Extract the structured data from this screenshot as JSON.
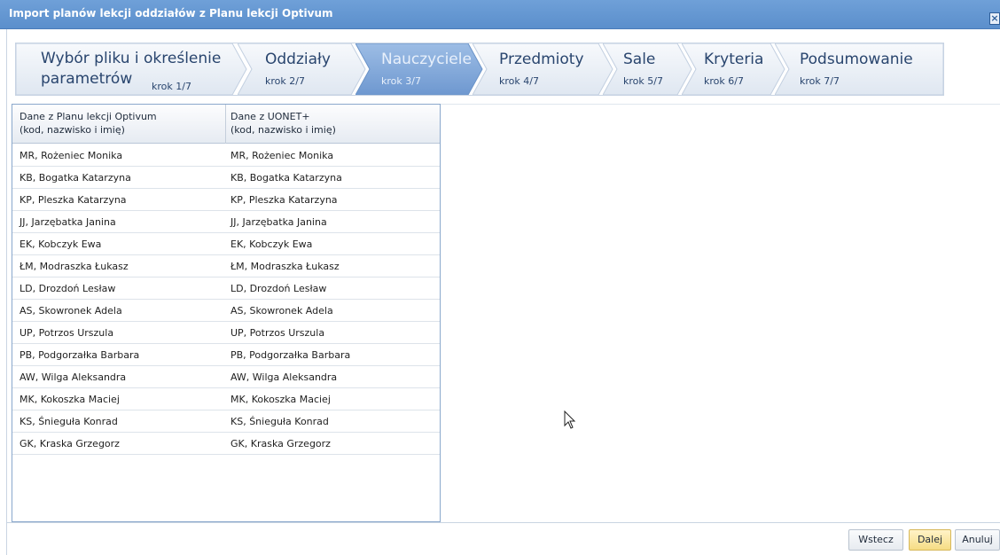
{
  "window": {
    "title": "Import planów lekcji oddziałów z Planu lekcji Optivum",
    "close_icon": "close-icon"
  },
  "wizard": {
    "active_step": 3,
    "steps": [
      {
        "label_line1": "Wybór pliku i określenie",
        "label_line2": "parametrów",
        "krok": "krok 1/7"
      },
      {
        "label": "Oddziały",
        "krok": "krok 2/7"
      },
      {
        "label": "Nauczyciele",
        "krok": "krok 3/7"
      },
      {
        "label": "Przedmioty",
        "krok": "krok 4/7"
      },
      {
        "label": "Sale",
        "krok": "krok 5/7"
      },
      {
        "label": "Kryteria",
        "krok": "krok 6/7"
      },
      {
        "label": "Podsumowanie",
        "krok": "krok 7/7"
      }
    ]
  },
  "table": {
    "headers": [
      {
        "line1": "Dane z Planu lekcji Optivum",
        "line2": "(kod, nazwisko i imię)"
      },
      {
        "line1": "Dane z UONET+",
        "line2": "(kod, nazwisko i imię)"
      }
    ],
    "rows": [
      [
        "MR, Rożeniec Monika",
        "MR, Rożeniec Monika"
      ],
      [
        "KB, Bogatka Katarzyna",
        "KB, Bogatka Katarzyna"
      ],
      [
        "KP, Pleszka Katarzyna",
        "KP, Pleszka Katarzyna"
      ],
      [
        "JJ, Jarzębatka Janina",
        "JJ, Jarzębatka Janina"
      ],
      [
        "EK, Kobczyk Ewa",
        "EK, Kobczyk Ewa"
      ],
      [
        "ŁM, Modraszka Łukasz",
        "ŁM, Modraszka Łukasz"
      ],
      [
        "LD, Drozdoń Lesław",
        "LD, Drozdoń Lesław"
      ],
      [
        "AS, Skowronek Adela",
        "AS, Skowronek Adela"
      ],
      [
        "UP, Potrzos Urszula",
        "UP, Potrzos Urszula"
      ],
      [
        "PB, Podgorzałka Barbara",
        "PB, Podgorzałka Barbara"
      ],
      [
        "AW, Wilga Aleksandra",
        "AW, Wilga Aleksandra"
      ],
      [
        "MK, Kokoszka Maciej",
        "MK, Kokoszka Maciej"
      ],
      [
        "KS, Śnieguła Konrad",
        "KS, Śnieguła Konrad"
      ],
      [
        "GK, Kraska Grzegorz",
        "GK, Kraska Grzegorz"
      ]
    ]
  },
  "buttons": {
    "back": "Wstecz",
    "next": "Dalej",
    "cancel": "Anuluj"
  },
  "colors": {
    "titlebar": "#5b8fcc",
    "active_step": "#7ea5d8",
    "next_button": "#f6dd84"
  }
}
